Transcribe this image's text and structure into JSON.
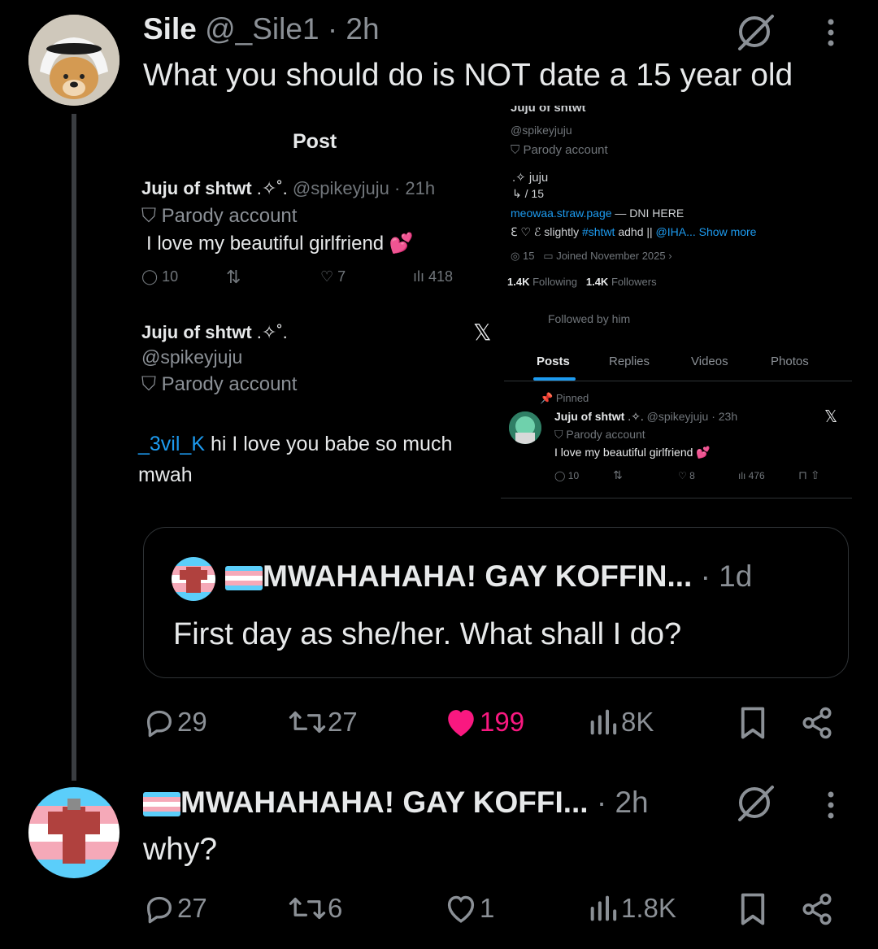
{
  "tweet1": {
    "display_name": "Sile",
    "handle": "@_Sile1",
    "time": "2h",
    "text": "What you should do is NOT date a 15 year old",
    "actions": {
      "replies": "29",
      "reposts": "27",
      "likes": "199",
      "views": "8K"
    },
    "colors": {
      "liked": "#f91880"
    }
  },
  "screenshot_left": {
    "header": "Post",
    "post1": {
      "name": "Juju of shtwt",
      "handle_time": "@spikeyjuju · 21h",
      "badge": "Parody account",
      "text": "I love my beautiful girlfriend",
      "replies": "10",
      "likes": "7",
      "views": "418"
    },
    "post2": {
      "name": "Juju of shtwt",
      "handle": "@spikeyjuju",
      "badge": "Parody account",
      "mention": "_3vil_K",
      "text": "hi I love you babe so much",
      "text2": "mwah"
    }
  },
  "screenshot_right": {
    "name_cut": "Juju of shtwt",
    "handle": "@spikeyjuju",
    "badge": "Parody account",
    "bio_line1": "juju",
    "bio_line2": "/ 15",
    "link": "meowaa.straw.page",
    "link_suffix": "— DNI HERE",
    "bio_line3_a": "slightly",
    "bio_line3_tag": "#shtwt",
    "bio_line3_b": "adhd ||",
    "bio_line3_mention": "@IHA...",
    "show_more": "Show more",
    "location": "15",
    "joined": "Joined November 2025",
    "following_count": "1.4K",
    "following_label": "Following",
    "followers_count": "1.4K",
    "followers_label": "Followers",
    "followed_by": "Followed by him",
    "tabs": [
      "Posts",
      "Replies",
      "Videos",
      "Photos"
    ],
    "pinned_label": "Pinned",
    "pinned": {
      "name": "Juju of shtwt",
      "handle_time": "@spikeyjuju · 23h",
      "badge": "Parody account",
      "text": "I love my beautiful girlfriend",
      "replies": "10",
      "likes": "8",
      "views": "476"
    }
  },
  "quote": {
    "display_name": "MWAHAHAHA! GAY KOFFIN...",
    "time": "1d",
    "text": "First day as she/her. What shall I do?"
  },
  "tweet2": {
    "display_name": "MWAHAHAHA! GAY KOFFI...",
    "time": "2h",
    "text": "why?",
    "actions": {
      "replies": "27",
      "reposts": "6",
      "likes": "1",
      "views": "1.8K"
    }
  }
}
